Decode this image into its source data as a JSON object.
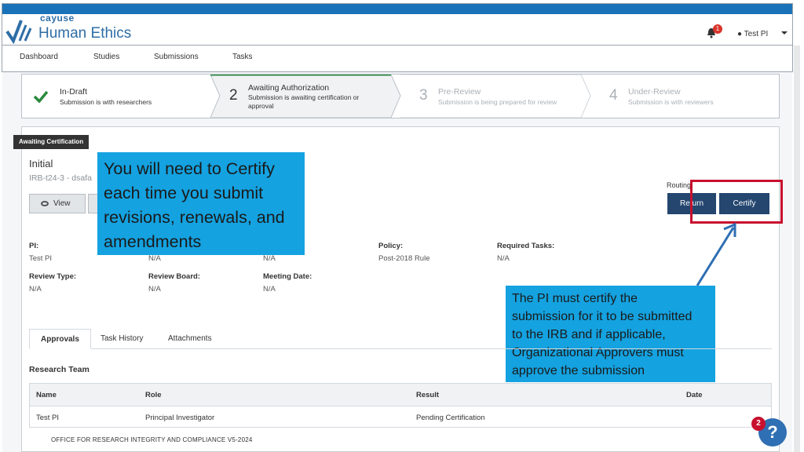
{
  "header": {
    "logo_small": "cayuse",
    "logo_big": "Human Ethics",
    "notification_count": "1",
    "user_name": "Test PI"
  },
  "nav": [
    "Dashboard",
    "Studies",
    "Submissions",
    "Tasks"
  ],
  "steps": [
    {
      "num": "",
      "title": "In-Draft",
      "sub": "Submission is with researchers"
    },
    {
      "num": "2",
      "title": "Awaiting Authorization",
      "sub1": "Submission is awaiting certification or",
      "sub2": "approval"
    },
    {
      "num": "3",
      "title": "Pre-Review",
      "sub": "Submission is being prepared for review"
    },
    {
      "num": "4",
      "title": "Under-Review",
      "sub": "Submission is with reviewers"
    }
  ],
  "submission": {
    "status_tag": "Awaiting Certification",
    "type": "Initial",
    "id": "IRB-t24-3 - dsafa",
    "view_label": "View",
    "routing_label": "Routing:",
    "return_label": "Return",
    "certify_label": "Certify"
  },
  "fields": {
    "pi_label": "PI:",
    "pi_value": "Test PI",
    "col2_value": "N/A",
    "col3_value": "N/A",
    "policy_label": "Policy:",
    "policy_value": "Post-2018 Rule",
    "tasks_label": "Required Tasks:",
    "tasks_value": "N/A",
    "review_type_label": "Review Type:",
    "review_type_value": "N/A",
    "review_board_label": "Review Board:",
    "review_board_value": "N/A",
    "meeting_date_label": "Meeting Date:",
    "meeting_date_value": "N/A"
  },
  "tabs": [
    "Approvals",
    "Task History",
    "Attachments"
  ],
  "research_team": {
    "title": "Research Team",
    "columns": [
      "Name",
      "Role",
      "Result",
      "Date"
    ],
    "rows": [
      [
        "Test PI",
        "Principal Investigator",
        "Pending Certification",
        ""
      ]
    ]
  },
  "callouts": {
    "a": [
      "You will need to Certify",
      "each time you submit",
      "revisions, renewals, and",
      "amendments"
    ],
    "b": [
      "The PI must certify the",
      "submission for it to be submitted",
      "to the IRB and if applicable,",
      "Organizational Approvers must",
      "approve the submission"
    ]
  },
  "footer": "OFFICE FOR RESEARCH INTEGRITY AND COMPLIANCE V5-2024",
  "help": {
    "badge": "2",
    "icon": "?"
  },
  "colors": {
    "header_blue": "#1a73b8",
    "button_navy": "#24466f",
    "callout_blue": "#14a2e0",
    "highlight_red": "#c8102e"
  }
}
